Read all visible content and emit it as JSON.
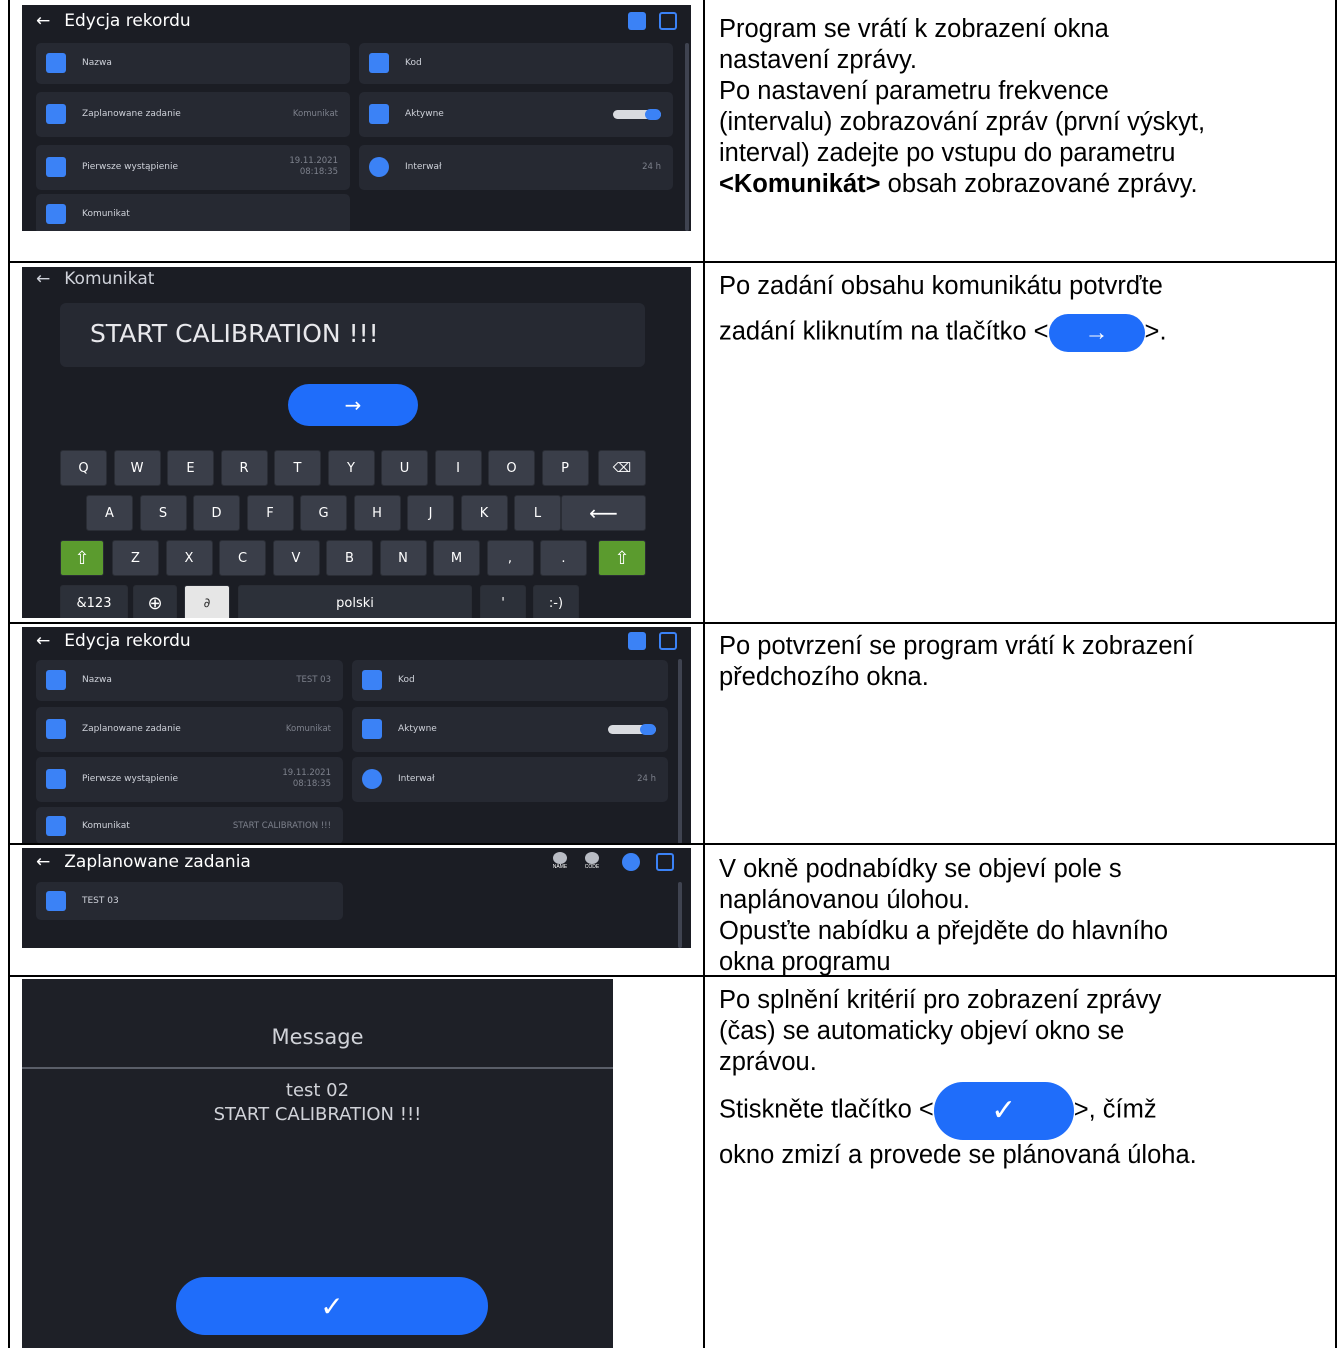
{
  "row1": {
    "screen_title": "Edycja rekordu",
    "cards": [
      {
        "label": "Nazwa",
        "value": ""
      },
      {
        "label": "Kod",
        "value": ""
      },
      {
        "label": "Zaplanowane zadanie",
        "value": "Komunikat"
      },
      {
        "label": "Aktywne",
        "value": ""
      },
      {
        "label": "Pierwsze wystąpienie",
        "value1": "19.11.2021",
        "value2": "08:18:35"
      },
      {
        "label": "Interwał",
        "value": "24 h"
      },
      {
        "label": "Komunikat",
        "value": ""
      }
    ],
    "desc": [
      "Program se vrátí k zobrazení okna",
      "nastavení zprávy.",
      "Po nastavení parametru frekvence",
      "(intervalu) zobrazování zpráv (první výskyt,",
      "interval) zadejte po vstupu do parametru"
    ],
    "desc_bold": "<Komunikát>",
    "desc_tail": " obsah zobrazované zprávy."
  },
  "row2": {
    "screen_title": "Komunikat",
    "input_value": "START CALIBRATION !!!",
    "arrow": "→",
    "keys_row1": [
      "Q",
      "W",
      "E",
      "R",
      "T",
      "Y",
      "U",
      "I",
      "O",
      "P"
    ],
    "keys_row2": [
      "A",
      "S",
      "D",
      "F",
      "G",
      "H",
      "J",
      "K",
      "L"
    ],
    "keys_row3": [
      "Z",
      "X",
      "C",
      "V",
      "B",
      "N",
      "M",
      ",",
      "."
    ],
    "key_123": "&123",
    "key_space": "polski",
    "key_apos": "'",
    "key_smile": ":-)",
    "desc_line1": "Po zadání obsahu komunikátu potvrďte",
    "desc_line2_pre": "zadání kliknutím na tlačítko <",
    "desc_line2_post": ">."
  },
  "row3": {
    "screen_title": "Edycja rekordu",
    "cards": [
      {
        "label": "Nazwa",
        "value": "TEST 03"
      },
      {
        "label": "Kod",
        "value": ""
      },
      {
        "label": "Zaplanowane zadanie",
        "value": "Komunikat"
      },
      {
        "label": "Aktywne",
        "value": ""
      },
      {
        "label": "Pierwsze wystąpienie",
        "value1": "19.11.2021",
        "value2": "08:18:35"
      },
      {
        "label": "Interwał",
        "value": "24 h"
      },
      {
        "label": "Komunikat",
        "value": "START CALIBRATION !!!"
      }
    ],
    "desc": [
      "Po potvrzení se program vrátí k zobrazení",
      "předchozího okna."
    ]
  },
  "row4": {
    "screen_title": "Zaplanowane zadania",
    "item": "TEST 03",
    "icon_name": "NAME",
    "icon_code": "CODE",
    "desc": [
      "V okně podnabídky se objeví pole s",
      "naplánovanou úlohou.",
      "Opusťte nabídku a přejděte do hlavního",
      "okna programu"
    ]
  },
  "row5": {
    "dialog_title": "Message",
    "line1": "test 02",
    "line2": "START CALIBRATION !!!",
    "check": "✓",
    "desc": [
      "Po splnění kritérií pro zobrazení zprávy",
      "(čas) se automaticky objeví okno se",
      "zprávou."
    ],
    "desc2_pre": "Stiskněte tlačítko <",
    "desc2_post": ">, čímž",
    "desc3": "okno zmizí a provede se plánovaná úloha."
  },
  "back_arrow": "←"
}
